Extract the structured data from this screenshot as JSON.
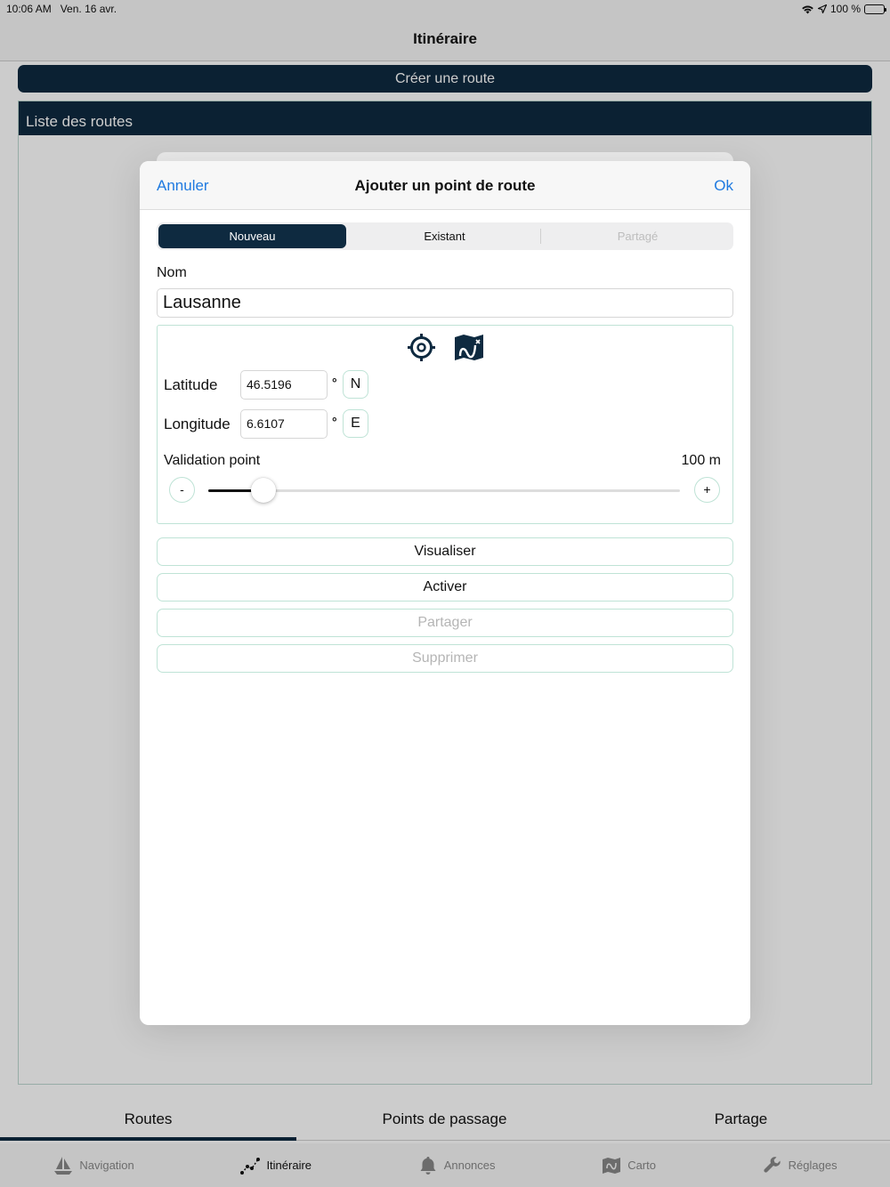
{
  "status": {
    "time": "10:06 AM",
    "date": "Ven. 16 avr.",
    "battery": "100 %"
  },
  "nav": {
    "title": "Itinéraire"
  },
  "create_route_label": "Créer une route",
  "routes_list": {
    "header": "Liste des routes"
  },
  "bottom_tabs": [
    {
      "label": "Routes",
      "active": true
    },
    {
      "label": "Points de passage",
      "active": false
    },
    {
      "label": "Partage",
      "active": false
    }
  ],
  "tabbar": [
    {
      "label": "Navigation",
      "icon": "sailboat-icon",
      "active": false
    },
    {
      "label": "Itinéraire",
      "icon": "route-icon",
      "active": true
    },
    {
      "label": "Annonces",
      "icon": "bell-icon",
      "active": false
    },
    {
      "label": "Carto",
      "icon": "map-icon",
      "active": false
    },
    {
      "label": "Réglages",
      "icon": "wrench-icon",
      "active": false
    }
  ],
  "modal": {
    "cancel_label": "Annuler",
    "title": "Ajouter un point de route",
    "ok_label": "Ok",
    "segments": [
      {
        "label": "Nouveau",
        "selected": true,
        "enabled": true
      },
      {
        "label": "Existant",
        "selected": false,
        "enabled": true
      },
      {
        "label": "Partagé",
        "selected": false,
        "enabled": false
      }
    ],
    "name_label": "Nom",
    "name_value": "Lausanne",
    "latitude_label": "Latitude",
    "latitude_value": "46.5196",
    "latitude_hemisphere": "N",
    "longitude_label": "Longitude",
    "longitude_value": "6.6107",
    "longitude_hemisphere": "E",
    "degree_symbol": "°",
    "validation_label": "Validation point",
    "validation_value": "100 m",
    "slider_fraction": 0.117,
    "minus_label": "-",
    "plus_label": "+",
    "actions": [
      {
        "label": "Visualiser",
        "enabled": true
      },
      {
        "label": "Activer",
        "enabled": true
      },
      {
        "label": "Partager",
        "enabled": false
      },
      {
        "label": "Supprimer",
        "enabled": false
      }
    ]
  },
  "colors": {
    "primary": "#0e2a40",
    "link": "#1f7ae0",
    "border": "#bfe3d6",
    "disabled": "#b5b5b5"
  }
}
